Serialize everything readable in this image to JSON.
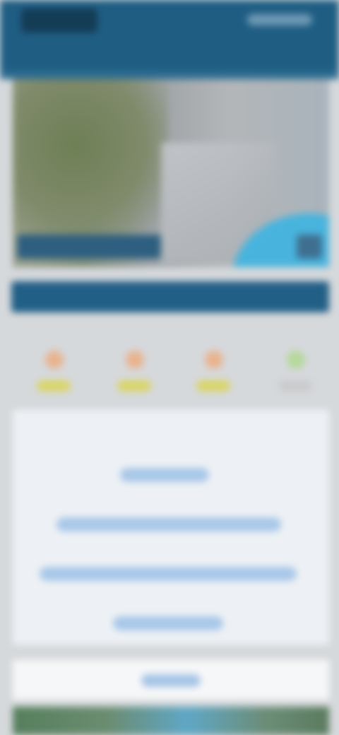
{
  "header": {
    "title": ""
  },
  "banner": {
    "text": ""
  },
  "forecast": {
    "days": [
      {
        "name": "",
        "icon": "sun-icon",
        "indicator": "yellow"
      },
      {
        "name": "",
        "icon": "sun-icon",
        "indicator": "yellow"
      },
      {
        "name": "",
        "icon": "sun-icon",
        "indicator": "yellow"
      },
      {
        "name": "",
        "icon": "sun-icon-green",
        "indicator": "gray"
      }
    ]
  },
  "links": {
    "title": "",
    "items": [
      "",
      "",
      "",
      ""
    ]
  },
  "button": {
    "label": ""
  },
  "colors": {
    "header": "#1f5d83",
    "banner": "#215f86",
    "link": "#3b7ac4",
    "panel": "#edf1f5"
  }
}
